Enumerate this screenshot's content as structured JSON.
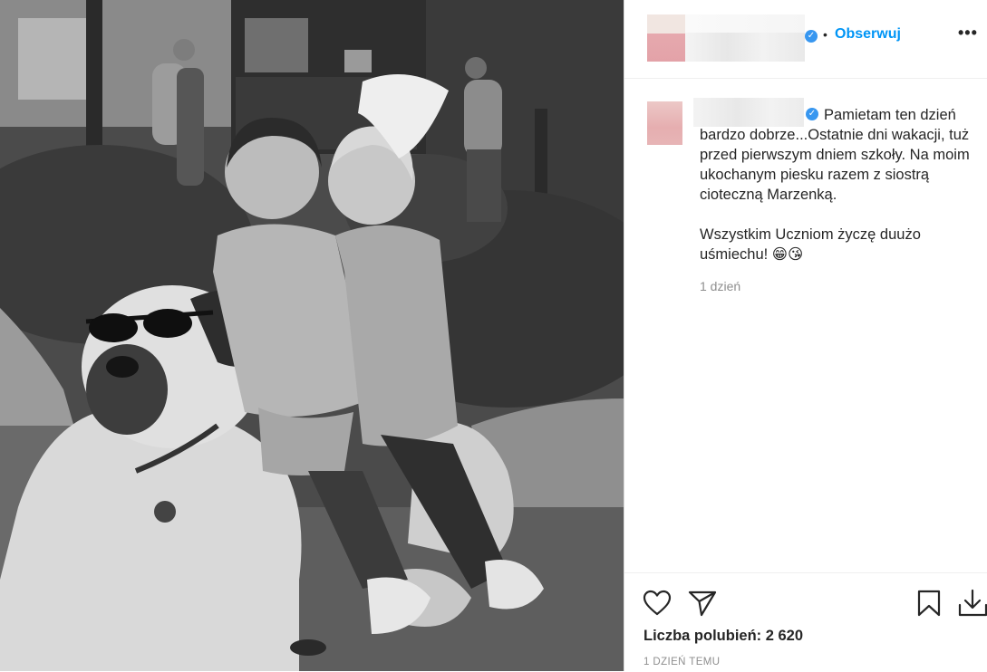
{
  "post": {
    "image_alt": "Black and white photo of two girls sitting on a large dog wearing sunglasses",
    "follow_label": "Obserwuj",
    "separator": "•",
    "more_label": "•••",
    "verified_glyph": "✓",
    "caption": "Pamietam ten dzień bardzo dobrze...Ostatnie dni wakacji, tuż przed pierwszym dniem szkoły. Na moim ukochanym piesku razem z siostrą cioteczną Marzenką.\n\nWszystkim Uczniom życzę duużo uśmiechu! 😁😘",
    "caption_time": "1 dzień",
    "likes": "Liczba polubień: 2 620",
    "posted_ago": "1 DZIEŃ TEMU"
  },
  "icons": {
    "like": "heart-icon",
    "share": "paper-plane-icon",
    "save": "bookmark-icon",
    "download": "download-icon"
  },
  "colors": {
    "accent": "#0095f6",
    "verified": "#3897f0",
    "text": "#262626",
    "muted": "#8e8e8e"
  }
}
